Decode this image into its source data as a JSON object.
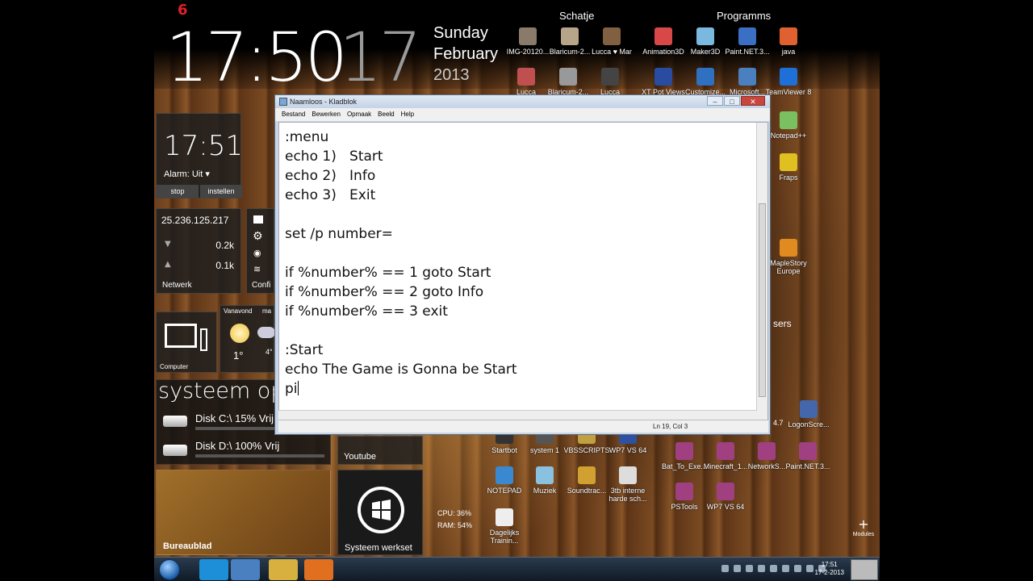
{
  "clock": {
    "big_time": "17:50",
    "seconds": "17",
    "day": "Sunday",
    "month": "February",
    "year": "2013"
  },
  "top_badge": "6",
  "groups": {
    "left_title": "Schatje",
    "right_title": "Programms"
  },
  "top_icons": [
    {
      "label": "IMG-20120...",
      "color": "#8a7a6a"
    },
    {
      "label": "Blaricum-2...",
      "color": "#b7a58a"
    },
    {
      "label": "Lucca ♥ Mar",
      "color": "#806040"
    },
    {
      "label": "Animation3D",
      "color": "#d84848"
    },
    {
      "label": "Maker3D",
      "color": "#7ab8e0"
    },
    {
      "label": "Paint.NET.3...",
      "color": "#3a6fc4"
    },
    {
      "label": "java",
      "color": "#e06030"
    }
  ],
  "second_row_icons": [
    {
      "label": "Lucca",
      "color": "#c05050"
    },
    {
      "label": "Blaricum-2...",
      "color": "#999999"
    },
    {
      "label": "Lucca",
      "color": "#444444"
    },
    {
      "label": "XT Pot Views",
      "color": "#2a4ca0"
    },
    {
      "label": "Customize...",
      "color": "#3070c0"
    },
    {
      "label": "Microsoft...",
      "color": "#4a80c0"
    },
    {
      "label": "TeamViewer 8",
      "color": "#1e6fd8"
    }
  ],
  "side_icons": [
    {
      "label": "Notepad++",
      "color": "#7ac060"
    },
    {
      "label": "Fraps",
      "color": "#e0c020"
    },
    {
      "label": "MapleStory Europe",
      "color": "#e08a20"
    },
    {
      "label": "LogonScre...",
      "color": "#4466aa"
    }
  ],
  "partial_text": {
    "sers": "sers",
    "four_seven": "4.7"
  },
  "tiles": {
    "alarm": {
      "time": "17:51",
      "status": "Alarm: Uit ▾",
      "stop": "stop",
      "settings": "instellen"
    },
    "network": {
      "ip": "25.236.125.217",
      "down": "0.2k",
      "up": "0.1k",
      "label": "Netwerk"
    },
    "config": {
      "label": "Confi"
    },
    "computer": {
      "label": "Computer"
    },
    "weather": {
      "today": "Vanavond",
      "temp": "1°",
      "tomorrow": "ma",
      "temp2": "4°"
    },
    "system": {
      "title": "systeem op",
      "disk_c": "Disk C:\\ 15% Vrij",
      "disk_d": "Disk D:\\ 100% Vrij"
    },
    "youtube": {
      "label": "Youtube"
    },
    "desktop": {
      "label": "Bureaublad"
    },
    "windows": {
      "label": "Systeem werkset"
    },
    "stats": {
      "cpu": "CPU: 36%",
      "ram": "RAM: 54%"
    }
  },
  "bottom_icons": [
    {
      "label": "Startbot",
      "color": "#333333"
    },
    {
      "label": "system 1",
      "color": "#555555"
    },
    {
      "label": "VBSSCRIPTS",
      "color": "#c0a040"
    },
    {
      "label": "WP7 VS 64",
      "color": "#3050a0"
    },
    {
      "label": "NOTEPAD",
      "color": "#3a88d0"
    },
    {
      "label": "Muziek",
      "color": "#8ac0e0"
    },
    {
      "label": "Soundtrac...",
      "color": "#d0a030"
    },
    {
      "label": "3tb interne harde sch...",
      "color": "#dddddd"
    },
    {
      "label": "Dagelijks Trainin...",
      "color": "#eeeeee"
    },
    {
      "label": "PSTools",
      "color": "#a04080"
    },
    {
      "label": "WP7 VS 64",
      "color": "#a04080"
    },
    {
      "label": "Bat_To_Exe...",
      "color": "#a04080"
    },
    {
      "label": "Minecraft_1...",
      "color": "#a04080"
    },
    {
      "label": "NetworkS...",
      "color": "#a04080"
    },
    {
      "label": "Paint.NET.3...",
      "color": "#a04080"
    }
  ],
  "modules_label": "Modules",
  "notepad": {
    "title": "Naamloos - Kladblok",
    "menu": [
      "Bestand",
      "Bewerken",
      "Opmaak",
      "Beeld",
      "Help"
    ],
    "content": ":menu\necho 1)   Start\necho 2)   Info\necho 3)   Exit\n\nset /p number=\n\nif %number% == 1 goto Start\nif %number% == 2 goto Info\nif %number% == 3 exit\n\n:Start\necho The Game is Gonna be Start\npi",
    "status": "Ln 19, Col 3",
    "btn_min": "–",
    "btn_max": "□",
    "btn_close": "✕"
  },
  "taskbar": {
    "time": "17:51",
    "date": "17-2-2013"
  }
}
